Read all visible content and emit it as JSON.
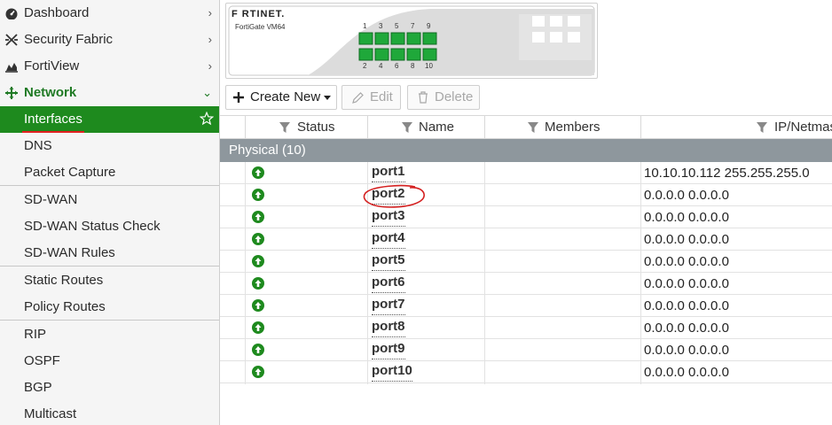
{
  "sidebar": {
    "items": [
      {
        "label": "Dashboard",
        "icon": "dashboard-gauge-icon",
        "chevron": "›"
      },
      {
        "label": "Security Fabric",
        "icon": "security-fabric-icon",
        "chevron": "›"
      },
      {
        "label": "FortiView",
        "icon": "fortiview-chart-icon",
        "chevron": "›"
      },
      {
        "label": "Network",
        "icon": "network-arrows-icon",
        "chevron": "⌄"
      }
    ],
    "network_children": [
      {
        "label": "Interfaces"
      },
      {
        "label": "DNS"
      },
      {
        "label": "Packet Capture"
      },
      {
        "label": "SD-WAN"
      },
      {
        "label": "SD-WAN Status Check"
      },
      {
        "label": "SD-WAN Rules"
      },
      {
        "label": "Static Routes"
      },
      {
        "label": "Policy Routes"
      },
      {
        "label": "RIP"
      },
      {
        "label": "OSPF"
      },
      {
        "label": "BGP"
      },
      {
        "label": "Multicast"
      }
    ]
  },
  "device": {
    "brand": "F RTINET.",
    "model": "FortiGate VM64",
    "port_top_labels": [
      "1",
      "3",
      "5",
      "7",
      "9"
    ],
    "port_bottom_labels": [
      "2",
      "4",
      "6",
      "8",
      "10"
    ]
  },
  "toolbar": {
    "create_new": "Create New",
    "edit": "Edit",
    "delete": "Delete"
  },
  "table": {
    "columns": [
      "Status",
      "Name",
      "Members",
      "IP/Netmas"
    ],
    "group_label": "Physical (10)",
    "rows": [
      {
        "name": "port1",
        "ip": "10.10.10.112 255.255.255.0",
        "status": "up"
      },
      {
        "name": "port2",
        "ip": "0.0.0.0 0.0.0.0",
        "status": "up"
      },
      {
        "name": "port3",
        "ip": "0.0.0.0 0.0.0.0",
        "status": "up"
      },
      {
        "name": "port4",
        "ip": "0.0.0.0 0.0.0.0",
        "status": "up"
      },
      {
        "name": "port5",
        "ip": "0.0.0.0 0.0.0.0",
        "status": "up"
      },
      {
        "name": "port6",
        "ip": "0.0.0.0 0.0.0.0",
        "status": "up"
      },
      {
        "name": "port7",
        "ip": "0.0.0.0 0.0.0.0",
        "status": "up"
      },
      {
        "name": "port8",
        "ip": "0.0.0.0 0.0.0.0",
        "status": "up"
      },
      {
        "name": "port9",
        "ip": "0.0.0.0 0.0.0.0",
        "status": "up"
      },
      {
        "name": "port10",
        "ip": "0.0.0.0 0.0.0.0",
        "status": "up"
      }
    ]
  },
  "colors": {
    "accent_green": "#1e8a1e",
    "network_green": "#1f7a24",
    "group_gray": "#8e979d",
    "annotation_red": "#e02020"
  }
}
